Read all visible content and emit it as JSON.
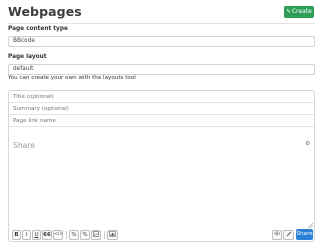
{
  "header": {
    "title": "Webpages",
    "create_label": "Create",
    "create_icon": "pencil-square-icon",
    "accent": "#2e9e57"
  },
  "form": {
    "content_type_label": "Page content type",
    "content_type_value": "BBcode",
    "layout_label": "Page layout",
    "layout_value": "default",
    "layout_help": "You can create your own with the layouts tool"
  },
  "editor": {
    "title_placeholder": "Title (optional)",
    "summary_placeholder": "Summary (optional)",
    "link_placeholder": "Page link name",
    "body_placeholder": "Share",
    "toolbar": {
      "bold": "B",
      "italic": "I",
      "underline": "U",
      "quote": "66",
      "code": "</>",
      "link": "%",
      "unlink": "%",
      "image": "img",
      "chart": "chart",
      "share_label": "Share",
      "share_color": "#2a7fd6"
    }
  }
}
